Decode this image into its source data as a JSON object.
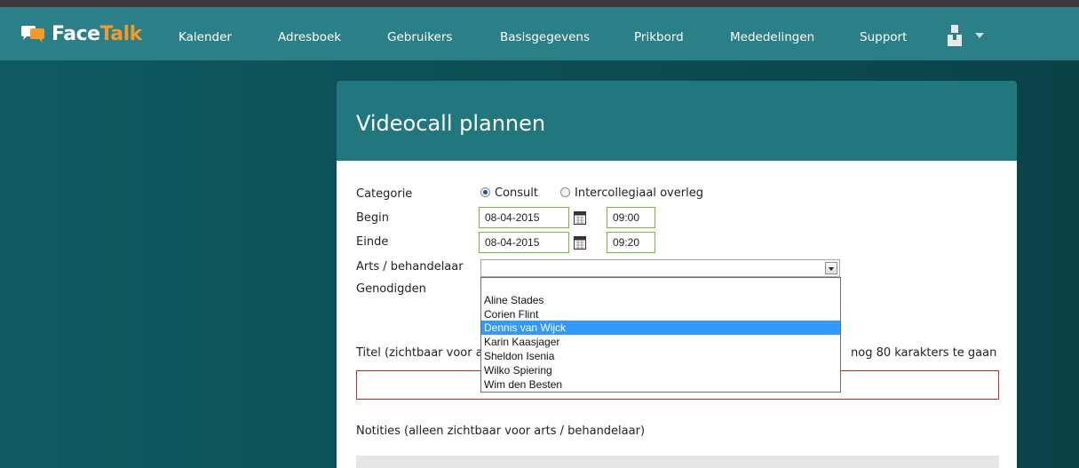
{
  "brand": {
    "face": "Face",
    "talk": "Talk"
  },
  "nav": [
    {
      "label": "Kalender"
    },
    {
      "label": "Adresboek"
    },
    {
      "label": "Gebruikers"
    },
    {
      "label": "Basisgegevens"
    },
    {
      "label": "Prikbord"
    },
    {
      "label": "Mededelingen"
    },
    {
      "label": "Support"
    }
  ],
  "page_title": "Videocall plannen",
  "form": {
    "categorie_label": "Categorie",
    "radio_consult": "Consult",
    "radio_overleg": "Intercollegiaal overleg",
    "selected_category": "Consult",
    "begin_label": "Begin",
    "begin_date": "08-04-2015",
    "begin_time": "09:00",
    "einde_label": "Einde",
    "einde_date": "08-04-2015",
    "einde_time": "09:20",
    "arts_label": "Arts / behandelaar",
    "arts_value": "",
    "genodigden_label": "Genodigden",
    "titel_label_visible": "Titel (zichtbaar voor a",
    "chars_remaining": "nog 80 karakters te gaan",
    "notities_label": "Notities (alleen zichtbaar voor arts / behandelaar)"
  },
  "dropdown_options": [
    {
      "label": ""
    },
    {
      "label": "Aline Stades"
    },
    {
      "label": "Corien Flint"
    },
    {
      "label": "Dennis van Wijck"
    },
    {
      "label": "Karin Kaasjager"
    },
    {
      "label": "Sheldon Isenia"
    },
    {
      "label": "Wilko Spiering"
    },
    {
      "label": "Wim den Besten"
    }
  ],
  "dropdown_highlighted": "Dennis van Wijck",
  "colors": {
    "navbar": "#2b7f86",
    "accent_orange": "#f39a2b",
    "panel_header": "#21777e",
    "input_border_green": "#7cb342",
    "input_border_error": "#c62828",
    "selection": "#3399ff"
  },
  "icons": {
    "logo": "speech-bubbles-icon",
    "user": "user-icon",
    "caret": "caret-down-icon",
    "calendar": "calendar-icon"
  }
}
